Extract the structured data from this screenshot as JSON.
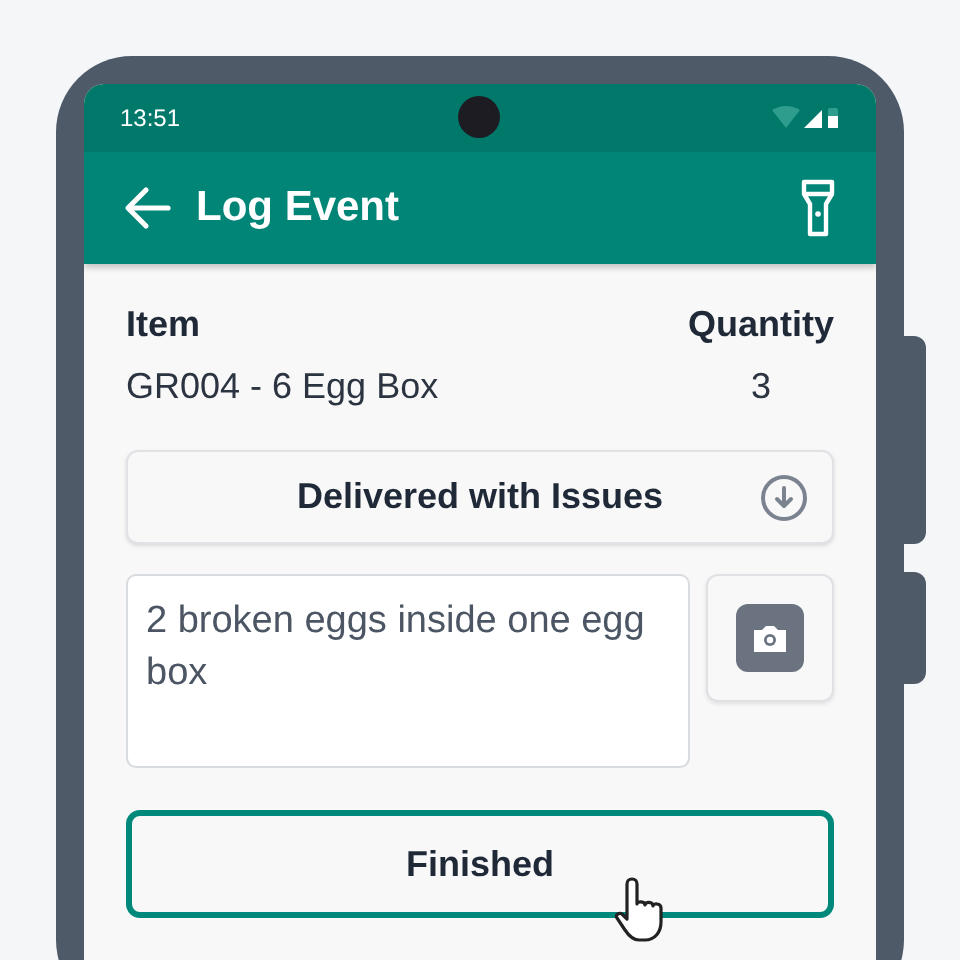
{
  "status_bar": {
    "time": "13:51"
  },
  "app_bar": {
    "title": "Log Event"
  },
  "columns": [
    {
      "heading": "Item",
      "value": "GR004 - 6 Egg Box"
    },
    {
      "heading": "Quantity",
      "value": "3"
    }
  ],
  "status_dropdown": {
    "value": "Delivered with Issues"
  },
  "notes": {
    "value": "2 broken eggs inside one egg box"
  },
  "finish_button": {
    "label": "Finished"
  }
}
